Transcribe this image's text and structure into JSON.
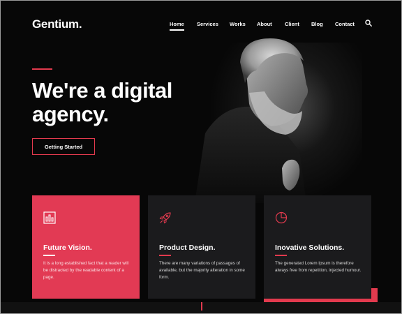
{
  "brand": {
    "logo": "Gentium."
  },
  "nav": {
    "items": [
      {
        "label": "Home",
        "active": true
      },
      {
        "label": "Services",
        "active": false
      },
      {
        "label": "Works",
        "active": false
      },
      {
        "label": "About",
        "active": false
      },
      {
        "label": "Client",
        "active": false
      },
      {
        "label": "Blog",
        "active": false
      },
      {
        "label": "Contact",
        "active": false
      }
    ],
    "search_icon": "search-icon"
  },
  "hero": {
    "title_line1": "We're a digital",
    "title_line2": "agency.",
    "cta_label": "Getting Started",
    "image": "bearded-man-portrait"
  },
  "cards": [
    {
      "icon": "bar-chart-icon",
      "title": "Future Vision.",
      "text": "It is a long established fact that a reader will be distracted by the readable content of a page."
    },
    {
      "icon": "rocket-icon",
      "title": "Product Design.",
      "text": "There are many variations of passages of available, but the majority alteration in some form."
    },
    {
      "icon": "pie-chart-icon",
      "title": "Inovative Solutions.",
      "text": "The generated Lorem Ipsum is therefore always free from repetition, injected humour."
    }
  ],
  "colors": {
    "accent": "#e23a4e",
    "card_primary": "#e23a54",
    "card_dark": "#1b1b1d",
    "background": "#070707"
  }
}
